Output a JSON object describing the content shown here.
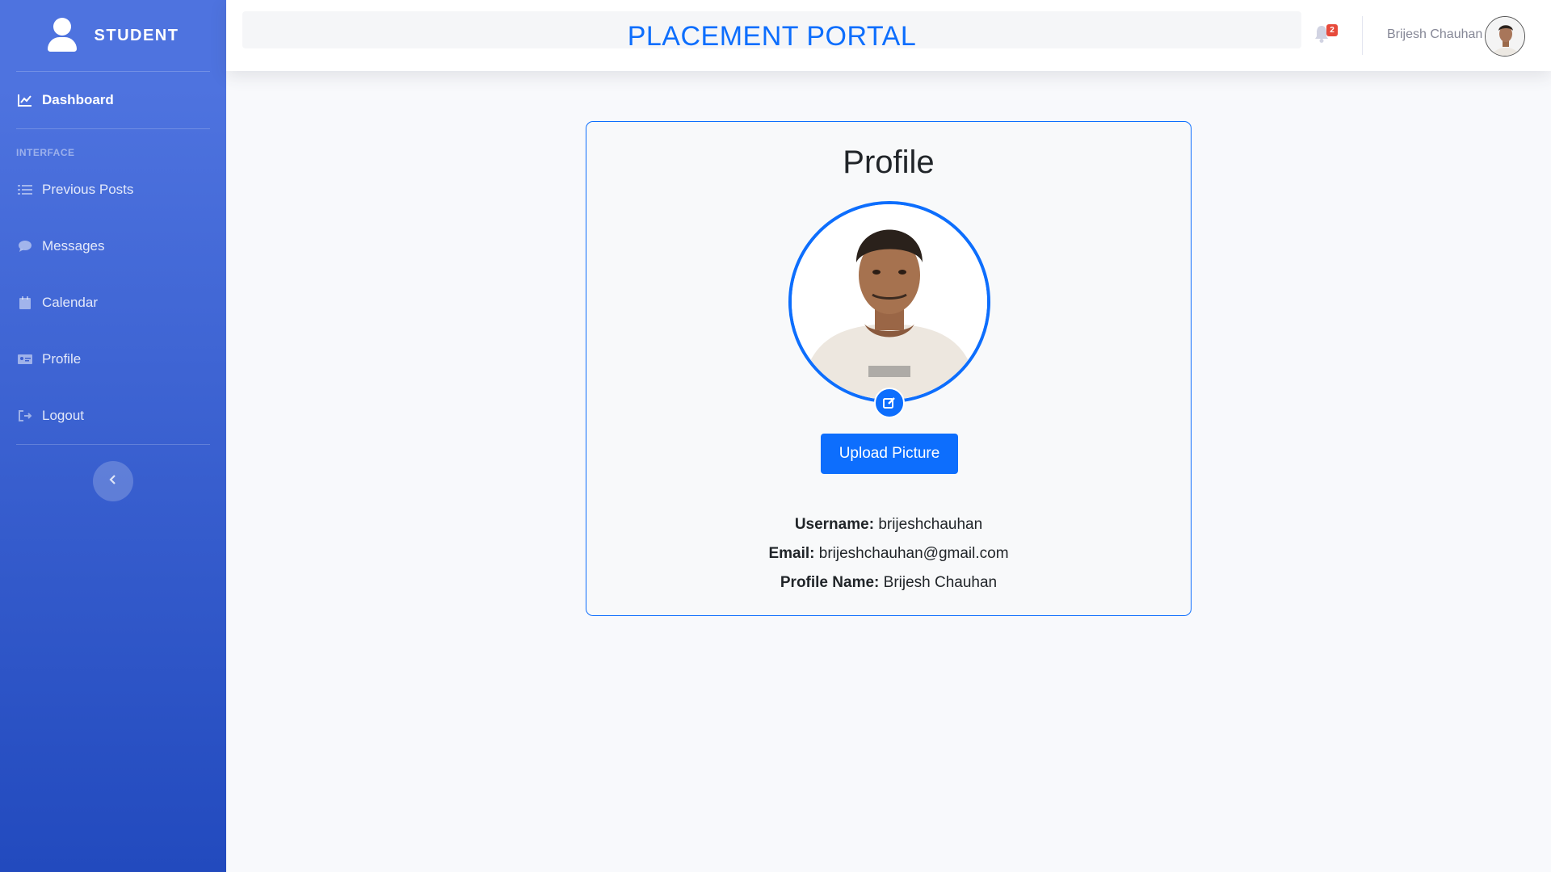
{
  "sidebar": {
    "brand": "STUDENT",
    "dashboard": "Dashboard",
    "heading": "INTERFACE",
    "items": [
      {
        "label": "Previous Posts",
        "icon": "list-icon"
      },
      {
        "label": "Messages",
        "icon": "chat-icon"
      },
      {
        "label": "Calendar",
        "icon": "calendar-icon"
      },
      {
        "label": "Profile",
        "icon": "id-card-icon"
      },
      {
        "label": "Logout",
        "icon": "logout-icon"
      }
    ]
  },
  "topbar": {
    "title": "PLACEMENT PORTAL",
    "notifications_count": "2",
    "user_name": "Brijesh Chauhan"
  },
  "profile": {
    "title": "Profile",
    "upload_button": "Upload Picture",
    "username_label": "Username:",
    "username": "brijeshchauhan",
    "email_label": "Email:",
    "email": "brijeshchauhan@gmail.com",
    "profile_name_label": "Profile Name:",
    "profile_name": "Brijesh Chauhan"
  },
  "colors": {
    "primary": "#0d6efd",
    "sidebar_top": "#4e73df",
    "sidebar_bottom": "#224abe",
    "badge": "#e74a3b"
  }
}
